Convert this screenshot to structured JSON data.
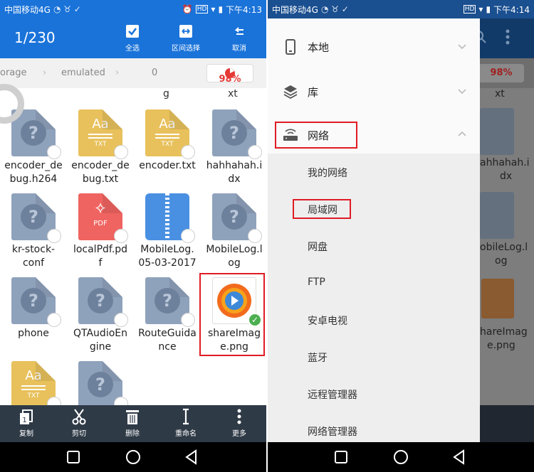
{
  "colors": {
    "primary": "#1a73d9",
    "danger": "#e53935",
    "selected": "#4caf50"
  },
  "status_bar": {
    "carrier": "中国移动4G",
    "time_left": "下午4:13",
    "time_right": "下午4:14",
    "hd": "HD"
  },
  "left": {
    "selection_count": "1/230",
    "toolbar": [
      {
        "label": "全选",
        "icon": "checkbox-icon"
      },
      {
        "label": "区间选择",
        "icon": "range-icon"
      },
      {
        "label": "取消",
        "icon": "undo-icon"
      }
    ],
    "breadcrumb": [
      "orage",
      "emulated",
      "0"
    ],
    "storage_badge": "98%",
    "partial_top": [
      "g",
      "xt"
    ],
    "files": [
      {
        "name": "encoder_debug.h264",
        "type": "unknown"
      },
      {
        "name": "encoder_debug.txt",
        "type": "txt"
      },
      {
        "name": "encoder.txt",
        "type": "txt"
      },
      {
        "name": "hahhahah.idx",
        "type": "unknown"
      },
      {
        "name": "kr-stock-conf",
        "type": "unknown"
      },
      {
        "name": "localPdf.pdf",
        "type": "pdf"
      },
      {
        "name": "MobileLog.05-03-2017",
        "type": "zip"
      },
      {
        "name": "MobileLog.log",
        "type": "unknown"
      },
      {
        "name": "phone",
        "type": "unknown"
      },
      {
        "name": "QTAudioEngine",
        "type": "unknown"
      },
      {
        "name": "RouteGuidance",
        "type": "unknown"
      },
      {
        "name": "shareImage.png",
        "type": "image",
        "selected": true
      },
      {
        "name": "",
        "type": "txt"
      },
      {
        "name": "",
        "type": "unknown"
      }
    ],
    "file_names_display": [
      [
        "encoder_de",
        "bug.h264"
      ],
      [
        "encoder_de",
        "bug.txt"
      ],
      [
        "encoder.txt",
        ""
      ],
      [
        "hahhahah.i",
        "dx"
      ],
      [
        "kr-stock-",
        "conf"
      ],
      [
        "localPdf.pd",
        "f"
      ],
      [
        "MobileLog.",
        "05-03-2017"
      ],
      [
        "MobileLog.l",
        "og"
      ],
      [
        "phone",
        ""
      ],
      [
        "QTAudioEn",
        "gine"
      ],
      [
        "RouteGuida",
        "nce"
      ],
      [
        "shareImag",
        "e.png"
      ],
      [
        "",
        ""
      ],
      [
        "",
        ""
      ]
    ],
    "file_tags": {
      "txt": "Aa",
      "txt_sub": "TXT",
      "pdf": "PDF"
    },
    "bottom_bar": [
      {
        "label": "复制",
        "icon": "copy-icon"
      },
      {
        "label": "剪切",
        "icon": "scissors-icon"
      },
      {
        "label": "删除",
        "icon": "trash-icon"
      },
      {
        "label": "重命名",
        "icon": "rename-icon"
      },
      {
        "label": "更多",
        "icon": "more-vert-icon"
      }
    ]
  },
  "right": {
    "ghost_badge": "98%",
    "ghost_texts": [
      "xt",
      "ahhahah.i",
      "dx",
      "obileLog.l",
      "og",
      "hareImag",
      "e.png"
    ],
    "drawer": {
      "main_items": [
        {
          "label": "本地",
          "icon": "phone-icon",
          "expanded": false
        },
        {
          "label": "库",
          "icon": "layers-icon",
          "expanded": false
        },
        {
          "label": "网络",
          "icon": "router-icon",
          "expanded": true
        }
      ],
      "sub_items": [
        "我的网络",
        "局域网",
        "网盘",
        "FTP",
        "安卓电视",
        "蓝牙",
        "远程管理器",
        "网络管理器"
      ]
    }
  }
}
